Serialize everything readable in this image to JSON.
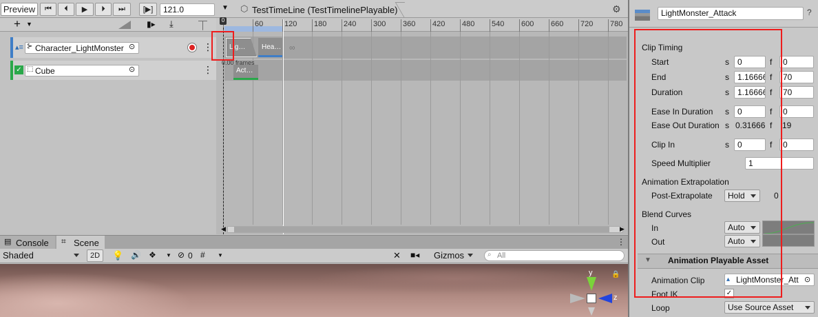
{
  "toolbar": {
    "preview": "Preview",
    "frame_value": "121.0",
    "step_label": "[▶]"
  },
  "breadcrumb": {
    "label": "TestTimeLine (TestTimelinePlayable)"
  },
  "ruler": {
    "ticks": [
      "0",
      "60",
      "120",
      "180",
      "240",
      "300",
      "360",
      "420",
      "480",
      "540",
      "600",
      "660",
      "720",
      "780"
    ]
  },
  "tracks": [
    {
      "name": "Character_LightMonster"
    },
    {
      "name": "Cube"
    }
  ],
  "clips": {
    "anim1": "Lig…",
    "anim2": "Hea…",
    "frames": "0.00 frames",
    "activation": "Act…"
  },
  "tabs": {
    "console": "Console",
    "scene": "Scene"
  },
  "scene_toolbar": {
    "shaded": "Shaded",
    "mode2d": "2D",
    "gizmo_count": "0",
    "gizmos": "Gizmos",
    "search_placeholder": "All"
  },
  "gizmo_axes": {
    "y": "y",
    "z": "z"
  },
  "inspector": {
    "asset_name": "LightMonster_Attack",
    "clip_timing": "Clip Timing",
    "rows": [
      {
        "label": "Start",
        "s": "0",
        "f": "0"
      },
      {
        "label": "End",
        "s": "1.16666",
        "f": "70"
      },
      {
        "label": "Duration",
        "s": "1.16666",
        "f": "70"
      },
      {
        "label": "Ease In Duration",
        "s": "0",
        "f": "0"
      },
      {
        "label": "Ease Out Duration",
        "s": "0.31666",
        "f": "19"
      },
      {
        "label": "Clip In",
        "s": "0",
        "f": "0"
      }
    ],
    "unit_s": "s",
    "unit_f": "f",
    "speed_label": "Speed Multiplier",
    "speed_value": "1",
    "extrapolation_header": "Animation Extrapolation",
    "post_label": "Post-Extrapolate",
    "post_value": "Hold",
    "post_number": "0",
    "blend_header": "Blend Curves",
    "in_label": "In",
    "in_value": "Auto",
    "out_label": "Out",
    "out_value": "Auto",
    "playable_header": "Animation Playable Asset",
    "anim_clip_label": "Animation Clip",
    "anim_clip_value": "LightMonster_Att",
    "foot_ik_label": "Foot IK",
    "foot_ik_check": "✓",
    "loop_label": "Loop",
    "loop_value": "Use Source Asset"
  }
}
